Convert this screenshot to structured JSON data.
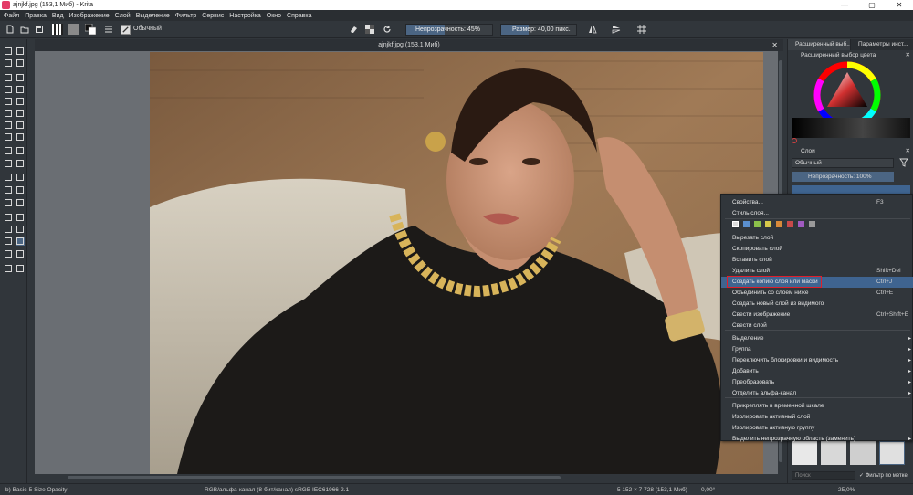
{
  "window": {
    "title": "ajnjkf.jpg (153,1 Миб) - Krita",
    "controls": [
      "—",
      "▢",
      "✕"
    ]
  },
  "menubar": [
    "Файл",
    "Правка",
    "Вид",
    "Изображение",
    "Слой",
    "Выделение",
    "Фильтр",
    "Сервис",
    "Настройка",
    "Окно",
    "Справка"
  ],
  "toolbar": {
    "blend_mode": "Обычный",
    "opacity_label": "Непрозрачность: 45%",
    "opacity_value": 0.45,
    "size_label": "Размер: 40,00 пикс."
  },
  "canvas": {
    "tab_title": "ajnjkf.jpg (153,1 Миб)"
  },
  "dock": {
    "tabs": [
      "Расширенный выб...",
      "Параметры инст..."
    ],
    "color_panel_title": "Расширенный выбор цвета",
    "layers_panel_title": "Слои",
    "layer_blend_mode": "Обычный",
    "layer_opacity": "Непрозрачность: 100%",
    "brush_search_placeholder": "Поиск",
    "filter_by_tag": "Фильтр по метке"
  },
  "context_menu": {
    "items": [
      {
        "label": "Свойства...",
        "shortcut": "F3"
      },
      {
        "label": "Стиль слоя..."
      },
      {
        "label": "Вырезать слой"
      },
      {
        "label": "Скопировать слой"
      },
      {
        "label": "Вставить слой"
      },
      {
        "label": "Удалить слой",
        "shortcut": "Shift+Del"
      },
      {
        "label": "Создать копию слоя или маски",
        "shortcut": "Ctrl+J",
        "highlighted": true
      },
      {
        "label": "Объединить со слоем ниже",
        "shortcut": "Ctrl+E"
      },
      {
        "label": "Создать новый слой из видимого"
      },
      {
        "label": "Свести изображение",
        "shortcut": "Ctrl+Shift+E"
      },
      {
        "label": "Свести слой"
      },
      {
        "label": "Выделение",
        "submenu": true
      },
      {
        "label": "Группа",
        "submenu": true
      },
      {
        "label": "Переключить блокировки и видимость",
        "submenu": true
      },
      {
        "label": "Добавить",
        "submenu": true
      },
      {
        "label": "Преобразовать",
        "submenu": true
      },
      {
        "label": "Отделить альфа-канал",
        "submenu": true
      },
      {
        "label": "Прикреплять в временной шкале"
      },
      {
        "label": "Изолировать активный слой"
      },
      {
        "label": "Изолировать активную группу"
      },
      {
        "label": "Выделить непрозрачную область (заменить)",
        "submenu": true
      }
    ],
    "label_colors": [
      "#5a8fcf",
      "#8cc04a",
      "#d8c84a",
      "#d88a3a",
      "#c84a4a",
      "#a05ac0",
      "#9a9a9a"
    ]
  },
  "statusbar": {
    "brush": "b) Basic-5 Size Opacity",
    "color_space": "RGB/альфа-канал (8-бит/канал)  sRGB IEC61966-2.1",
    "dimensions": "5 152 × 7 728 (153,1 Миб)",
    "rotation": "0,00°",
    "zoom": "25,0%"
  }
}
